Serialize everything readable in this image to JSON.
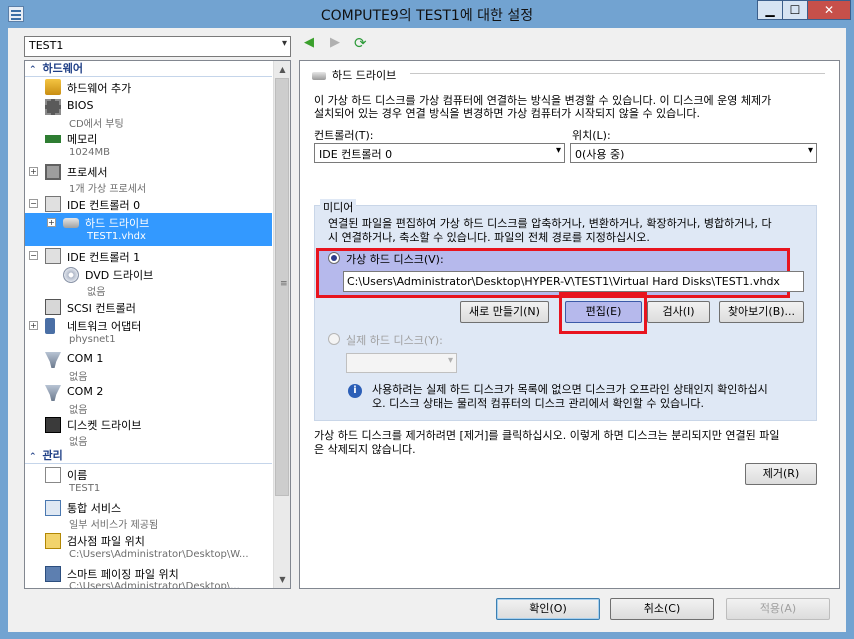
{
  "window": {
    "title": "COMPUTE9의 TEST1에 대한 설정"
  },
  "vm_selector": {
    "value": "TEST1"
  },
  "tree": {
    "hardware_header": "하드웨어",
    "management_header": "관리",
    "items": [
      {
        "label": "하드웨어 추가",
        "sub": ""
      },
      {
        "label": "BIOS",
        "sub": "CD에서 부팅"
      },
      {
        "label": "메모리",
        "sub": "1024MB"
      },
      {
        "label": "프로세서",
        "sub": "1개 가상 프로세서"
      },
      {
        "label": "IDE 컨트롤러 0",
        "sub": ""
      },
      {
        "label": "하드 드라이브",
        "sub": "TEST1.vhdx"
      },
      {
        "label": "IDE 컨트롤러 1",
        "sub": ""
      },
      {
        "label": "DVD 드라이브",
        "sub": "없음"
      },
      {
        "label": "SCSI 컨트롤러",
        "sub": ""
      },
      {
        "label": "네트워크 어댑터",
        "sub": "physnet1"
      },
      {
        "label": "COM 1",
        "sub": "없음"
      },
      {
        "label": "COM 2",
        "sub": "없음"
      },
      {
        "label": "디스켓 드라이브",
        "sub": "없음"
      },
      {
        "label": "이름",
        "sub": "TEST1"
      },
      {
        "label": "통합 서비스",
        "sub": "일부 서비스가 제공됨"
      },
      {
        "label": "검사점 파일 위치",
        "sub": "C:\\Users\\Administrator\\Desktop\\W..."
      },
      {
        "label": "스마트 페이징 파일 위치",
        "sub": "C:\\Users\\Administrator\\Desktop\\..."
      }
    ]
  },
  "panel": {
    "group_title": "하드 드라이브",
    "desc_line1": "이 가상 하드 디스크를 가상 컴퓨터에 연결하는 방식을 변경할 수 있습니다. 이 디스크에 운영 체제가",
    "desc_line2": "설치되어 있는 경우 연결 방식을 변경하면 가상 컴퓨터가 시작되지 않을 수 있습니다.",
    "controller_label": "컨트롤러(T):",
    "controller_value": "IDE 컨트롤러 0",
    "location_label": "위치(L):",
    "location_value": "0(사용 중)",
    "media_label": "미디어",
    "media_line1": "연결된 파일을 편집하여 가상 하드 디스크를 압축하거나, 변환하거나, 확장하거나, 병합하거나, 다",
    "media_line2": "시 연결하거나, 축소할 수 있습니다. 파일의 전체 경로를 지정하십시오.",
    "vhd_radio_label": "가상 하드 디스크(V):",
    "vhd_path": "C:\\Users\\Administrator\\Desktop\\HYPER-V\\TEST1\\Virtual Hard Disks\\TEST1.vhdx",
    "btn_new": "새로 만들기(N)",
    "btn_edit": "편집(E)",
    "btn_inspect": "검사(I)",
    "btn_browse": "찾아보기(B)...",
    "physical_radio_label": "실제 하드 디스크(Y):",
    "physical_value": "",
    "info_line1": "사용하려는 실제 하드 디스크가 목록에 없으면 디스크가 오프라인 상태인지 확인하십시",
    "info_line2": "오. 디스크 상태는 물리적 컴퓨터의 디스크 관리에서 확인할 수 있습니다.",
    "remove_line1": "가상 하드 디스크를 제거하려면 [제거]를 클릭하십시오. 이렇게 하면 디스크는 분리되지만 연결된 파일",
    "remove_line2": "은 삭제되지 않습니다.",
    "btn_remove": "제거(R)"
  },
  "footer": {
    "ok": "확인(O)",
    "cancel": "취소(C)",
    "apply": "적용(A)"
  },
  "colors": {
    "selection": "#3399ff",
    "highlight_red": "#e8141e",
    "highlight_fill": "#b6b9ec"
  }
}
